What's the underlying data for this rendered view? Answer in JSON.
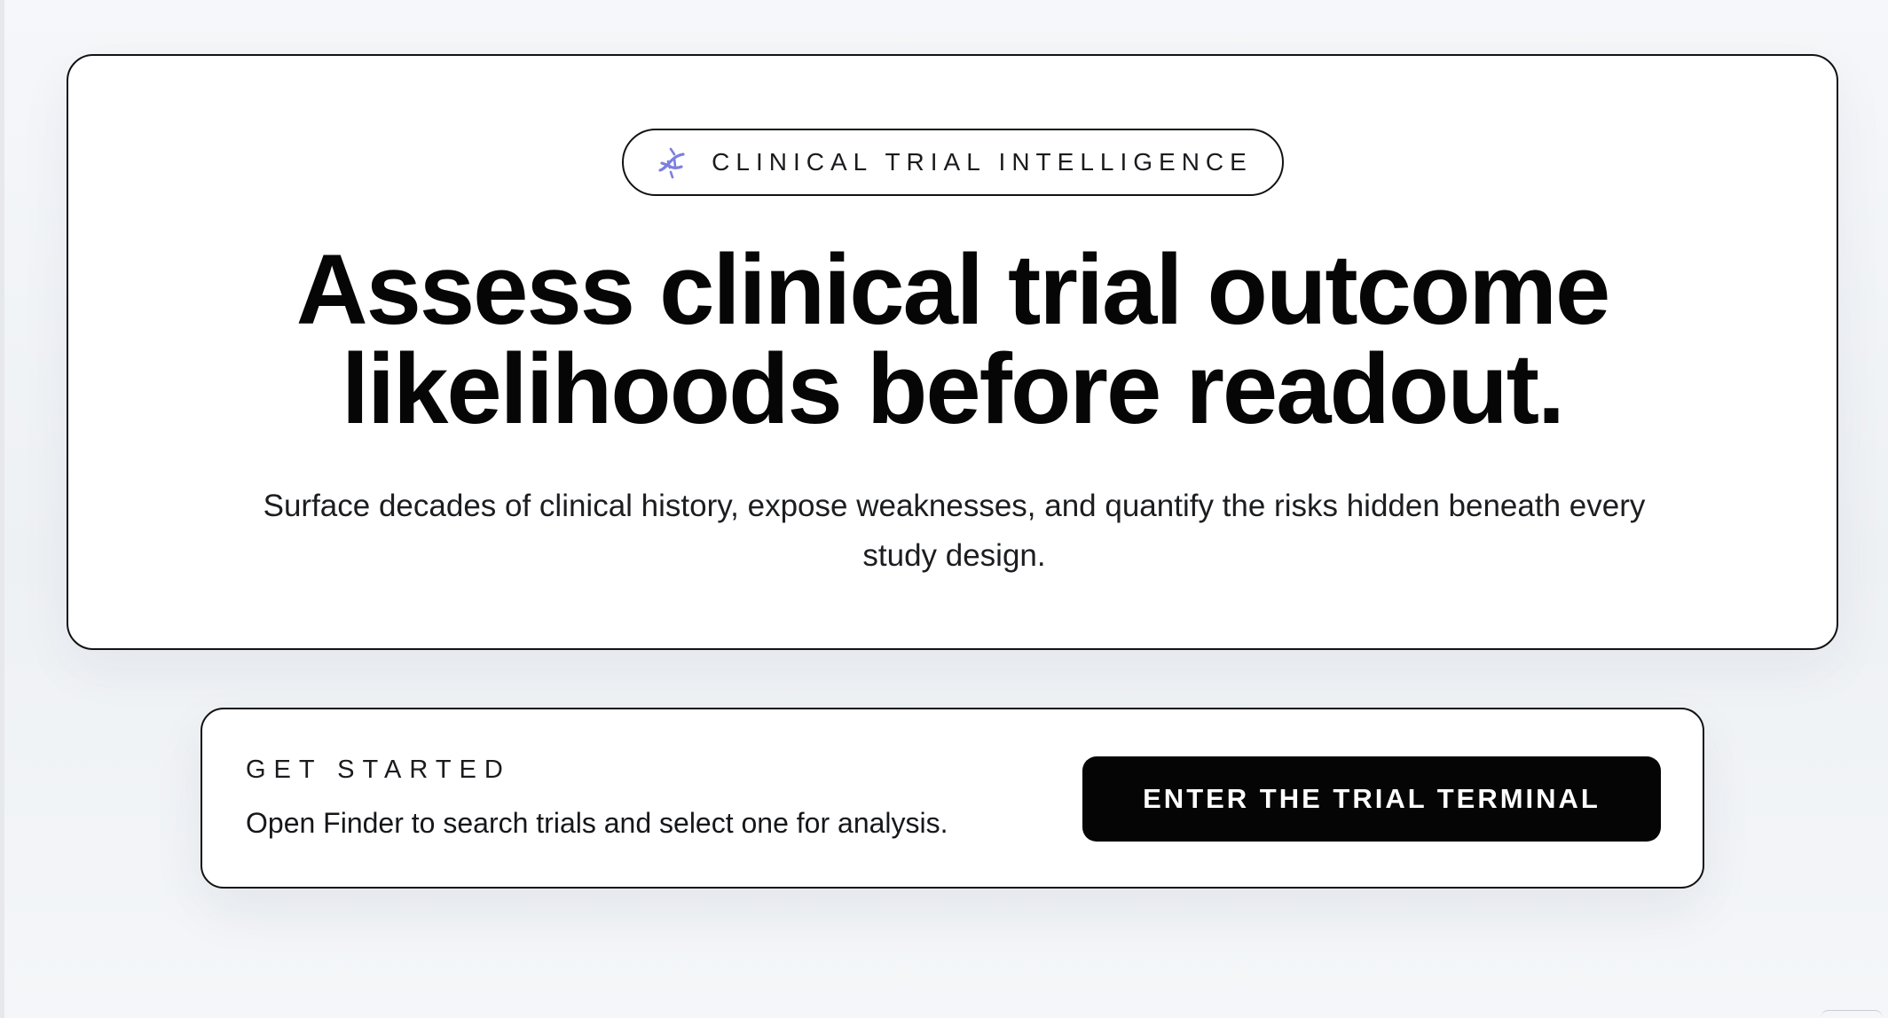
{
  "hero": {
    "eyebrow_icon": "dna-icon",
    "eyebrow": "CLINICAL TRIAL INTELLIGENCE",
    "headline_line1": "Assess clinical trial outcome",
    "headline_line2": "likelihoods before readout.",
    "subhead": "Surface decades of clinical history, expose weaknesses, and quantify the risks hidden beneath every study design."
  },
  "cta": {
    "eyebrow": "GET STARTED",
    "description": "Open Finder to search trials and select one for analysis.",
    "button_label": "ENTER THE TRIAL TERMINAL"
  },
  "colors": {
    "accent_icon": "#7b7fe0",
    "button_bg": "#050505",
    "page_bg": "#f3f5f8"
  }
}
